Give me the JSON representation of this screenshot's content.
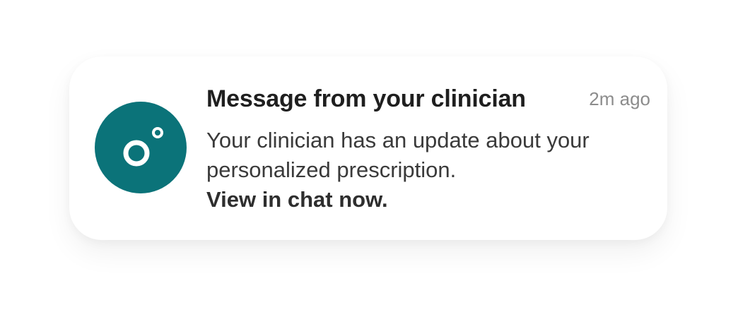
{
  "notification": {
    "app_icon": "app-logo-icon",
    "icon_color": "#0b7379",
    "title": "Message from your clinician",
    "timestamp": "2m ago",
    "body_line1": "Your clinician has an update about your",
    "body_line2": "personalized prescription.",
    "cta": "View in chat now."
  }
}
